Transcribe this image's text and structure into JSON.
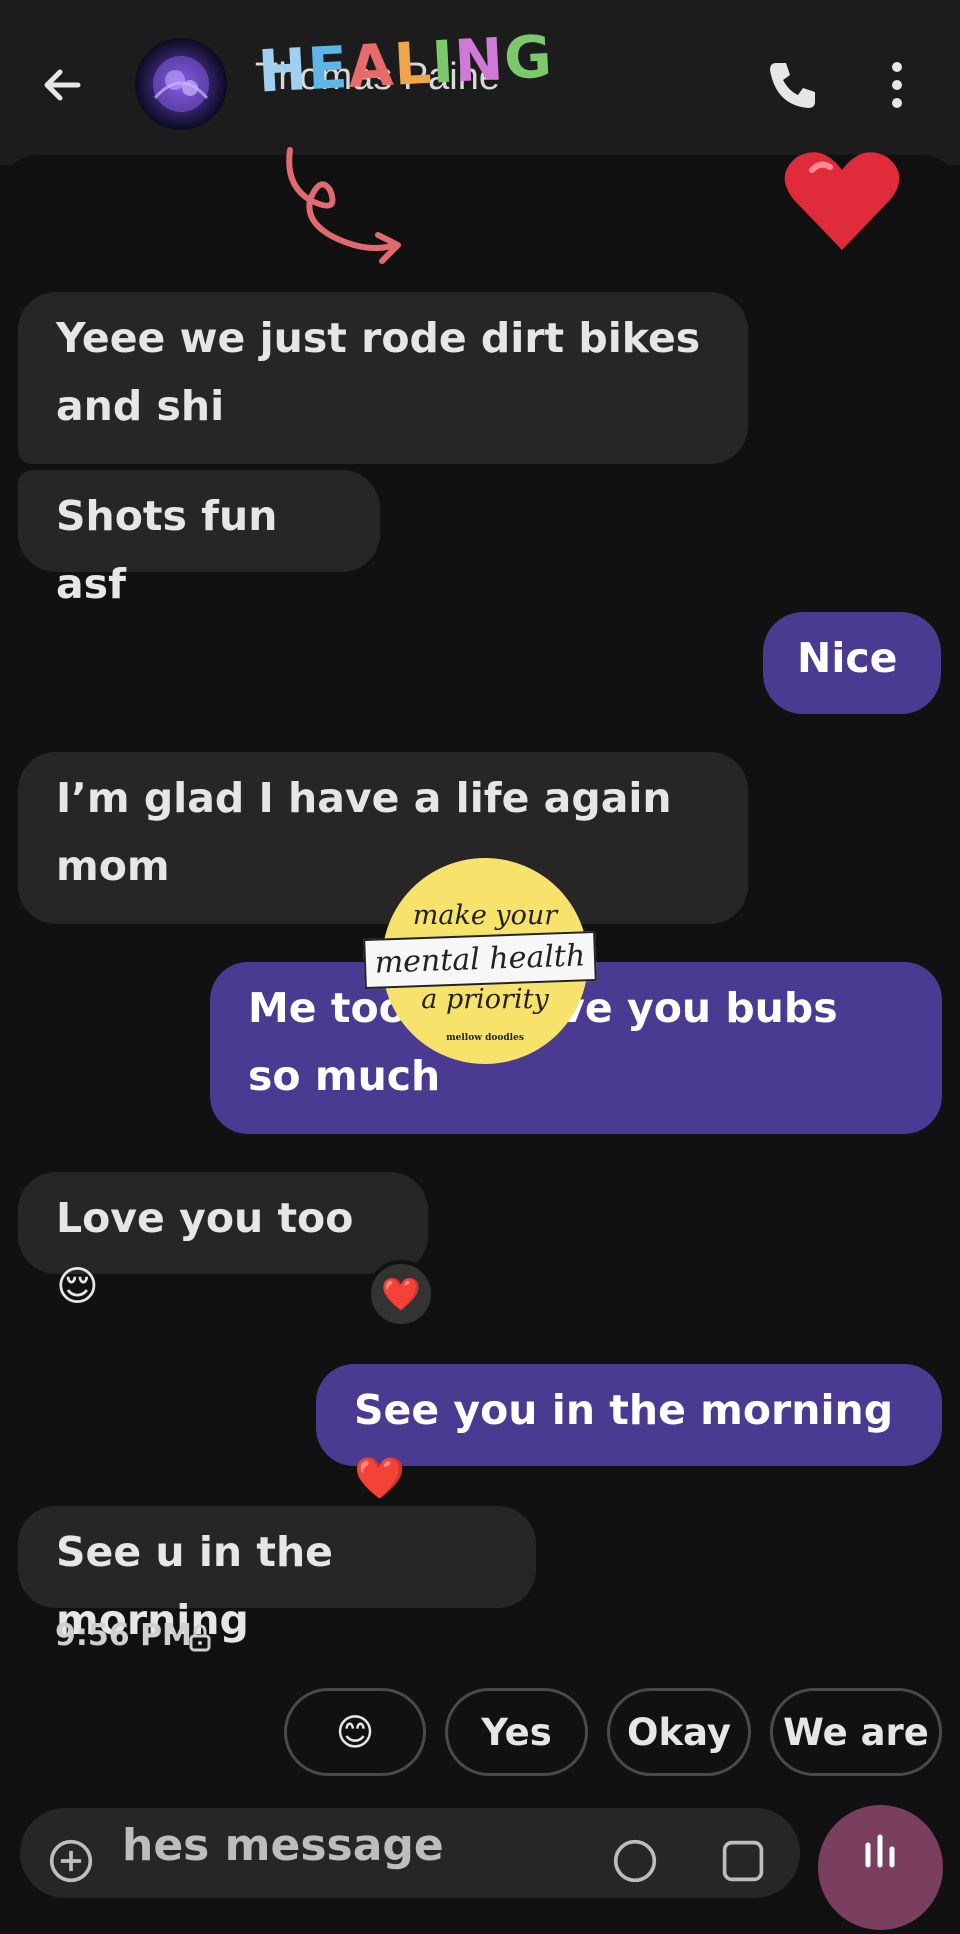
{
  "app_bar": {
    "contact_name": "Thomas Paine",
    "overlay_text": "HEALING",
    "overlay_colors": [
      "#e86a6a",
      "#f0a54a",
      "#f1d64a",
      "#7cc86a",
      "#5fb6e6",
      "#8a7ae0",
      "#d07ad8"
    ]
  },
  "messages": [
    {
      "from": "them",
      "text_lines": [
        "Yeee we just rode dirt bikes",
        "and shi"
      ]
    },
    {
      "from": "them",
      "text_lines": [
        "Shots fun asf"
      ]
    },
    {
      "from": "me",
      "text_lines": [
        "Nice"
      ]
    },
    {
      "from": "them",
      "text_lines": [
        "I’m glad I have a life again",
        "mom"
      ]
    },
    {
      "from": "me",
      "text_lines": [
        "Me too ❤️ I love you bubs",
        "so much"
      ]
    },
    {
      "from": "them",
      "text_lines": [
        "Love you too 😌"
      ],
      "reaction": "❤️"
    },
    {
      "from": "me",
      "text_lines": [
        "See you in the morning ❤️"
      ]
    },
    {
      "from": "them",
      "text_lines": [
        "See u in the morning"
      ]
    }
  ],
  "timestamp": "9:56 PM",
  "smart_replies": [
    "😊",
    "Yes",
    "Okay",
    "We are"
  ],
  "composer": {
    "placeholder": "Text message",
    "visible_text": "hes message"
  },
  "sticker": {
    "line1": "make your",
    "line2": "mental health",
    "line3": "a priority",
    "credit": "mellow doodles"
  },
  "colors": {
    "background": "#111111",
    "incoming_bubble": "#262626",
    "outgoing_bubble": "#4b3a91",
    "mic_button": "#7a3f5e",
    "sticker_yellow": "#f7e36b"
  }
}
